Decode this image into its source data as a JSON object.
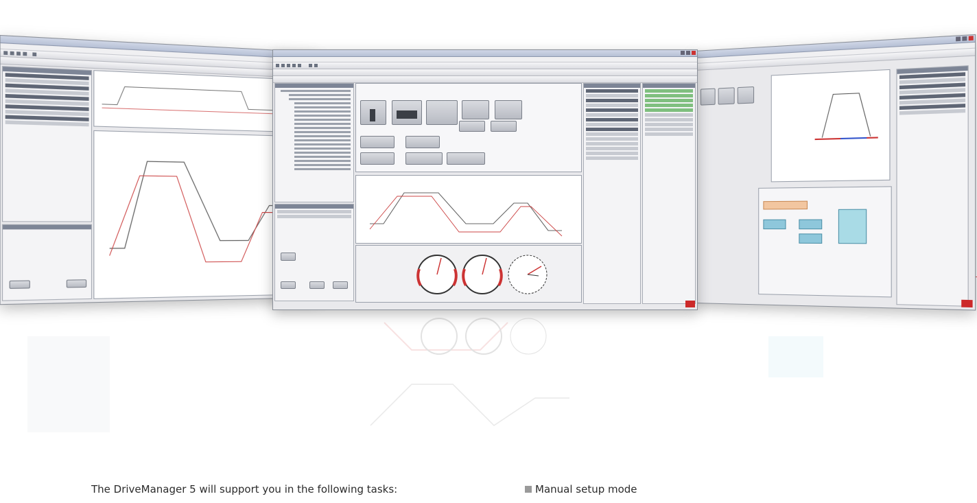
{
  "caption": {
    "text": "The DriveManager 5 will support you in the following tasks:"
  },
  "bullet_list": [
    {
      "label": "Manual setup mode"
    }
  ],
  "colors": {
    "accent_red": "#d44444",
    "window_chrome": "#b7c1d6",
    "trace_primary": "#666666",
    "trace_secondary": "#cc4444",
    "gauge_face": "#ffffff",
    "bullet": "#9a9a9a"
  },
  "icons": {
    "bullet": "square-bullet-icon",
    "lti_logo": "lti-logo-icon"
  }
}
